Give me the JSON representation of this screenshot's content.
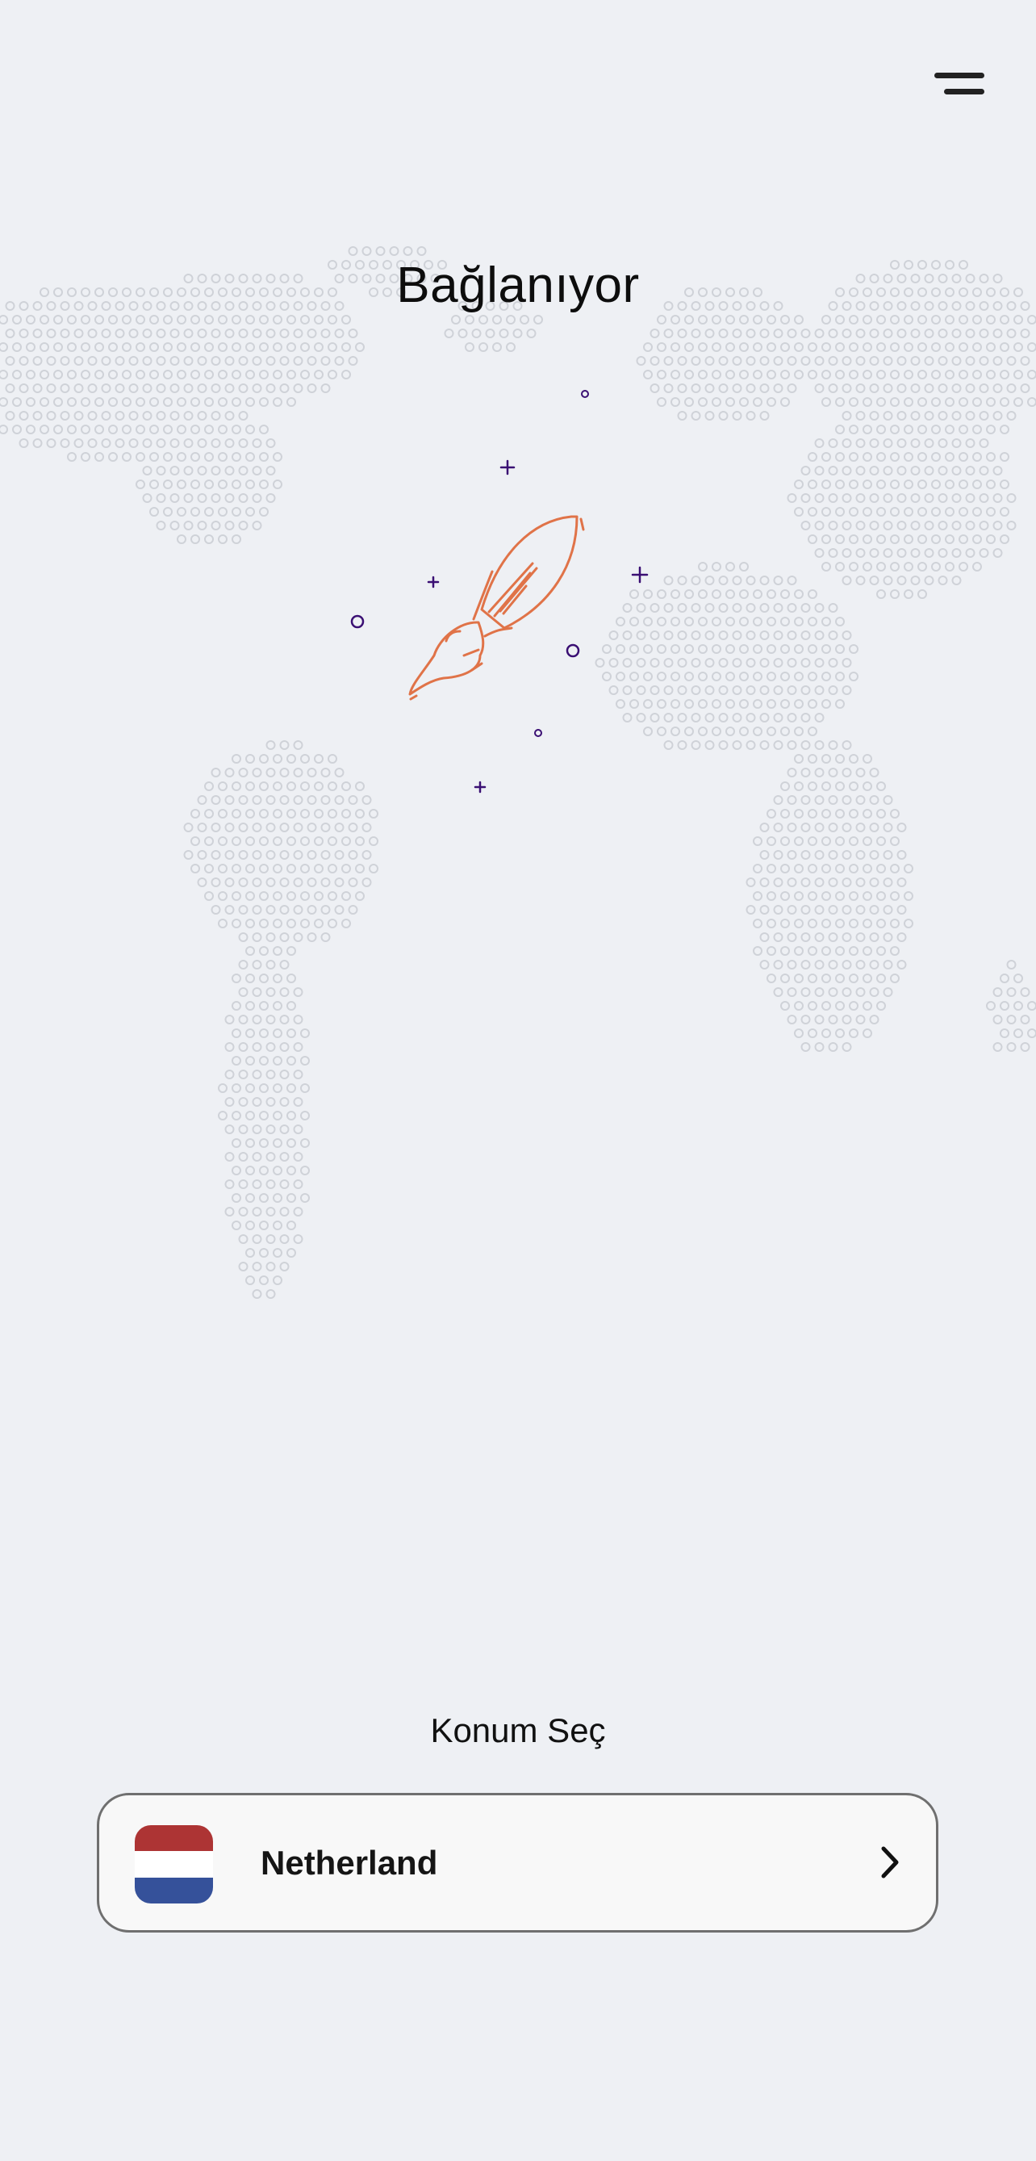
{
  "header": {
    "menu_icon": "hamburger-menu-icon"
  },
  "status": {
    "title": "Bağlanıyor",
    "illustration_icon": "rocket-icon",
    "rocket_color": "#e07348",
    "sparkle_color": "#3a0f73"
  },
  "map": {
    "icon": "dotted-world-map",
    "dot_color": "#cfd2d8"
  },
  "location": {
    "heading": "Konum Seç",
    "selected": {
      "name": "Netherland",
      "flag_icon": "netherlands-flag-icon",
      "flag_colors": [
        "#ad3434",
        "#ffffff",
        "#35519a"
      ],
      "chevron_icon": "chevron-right-icon"
    }
  },
  "theme": {
    "background": "#eef0f4",
    "card_background": "#f8f8f8",
    "card_border": "#6f6f6f"
  }
}
